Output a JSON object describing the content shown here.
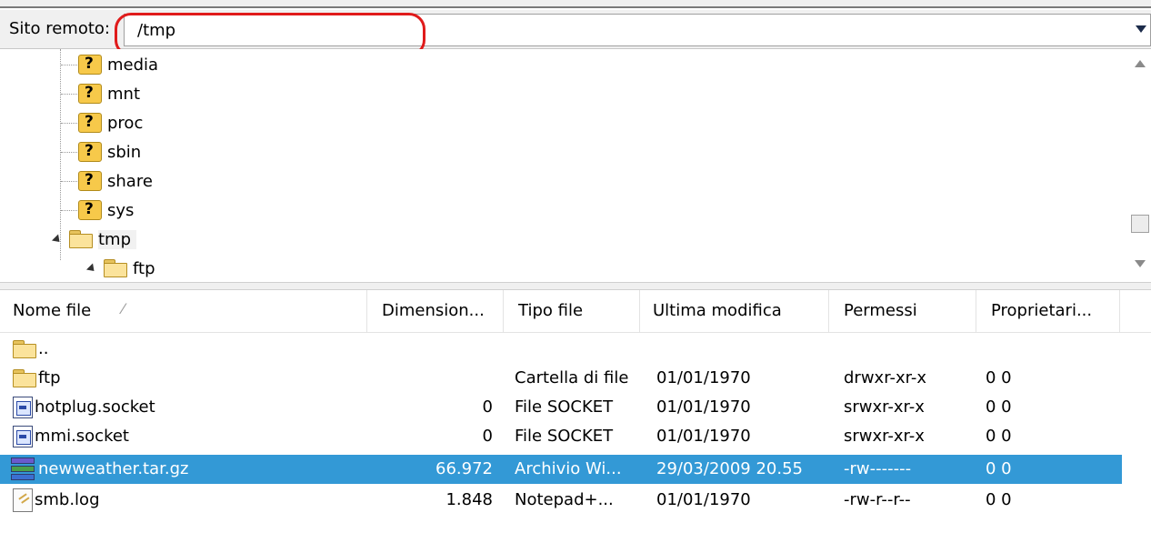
{
  "remote": {
    "label": "Sito remoto:",
    "path": "/tmp"
  },
  "tree": {
    "items": [
      {
        "label": "media",
        "icon": "unknown-folder-icon"
      },
      {
        "label": "mnt",
        "icon": "unknown-folder-icon"
      },
      {
        "label": "proc",
        "icon": "unknown-folder-icon"
      },
      {
        "label": "sbin",
        "icon": "unknown-folder-icon"
      },
      {
        "label": "share",
        "icon": "unknown-folder-icon"
      },
      {
        "label": "sys",
        "icon": "unknown-folder-icon"
      },
      {
        "label": "tmp",
        "icon": "folder-icon",
        "expanded": true,
        "selected": true
      },
      {
        "label": "ftp",
        "icon": "folder-icon",
        "expanded": true
      }
    ]
  },
  "columns": {
    "name": "Nome file",
    "size": "Dimension...",
    "type": "Tipo file",
    "modified": "Ultima modifica",
    "perms": "Permessi",
    "owner": "Proprietari..."
  },
  "files": [
    {
      "name": "..",
      "size": "",
      "type": "",
      "modified": "",
      "perms": "",
      "owner": "",
      "icon": "folder-up-icon"
    },
    {
      "name": "ftp",
      "size": "",
      "type": "Cartella di file",
      "modified": "01/01/1970",
      "perms": "drwxr-xr-x",
      "owner": "0 0",
      "icon": "folder-icon"
    },
    {
      "name": "hotplug.socket",
      "size": "0",
      "type": "File SOCKET",
      "modified": "01/01/1970",
      "perms": "srwxr-xr-x",
      "owner": "0 0",
      "icon": "socket-file-icon"
    },
    {
      "name": "mmi.socket",
      "size": "0",
      "type": "File SOCKET",
      "modified": "01/01/1970",
      "perms": "srwxr-xr-x",
      "owner": "0 0",
      "icon": "socket-file-icon"
    },
    {
      "name": "newweather.tar.gz",
      "size": "66.972",
      "type": "Archivio Wi...",
      "modified": "29/03/2009 20.55",
      "perms": "-rw-------",
      "owner": "0 0",
      "icon": "archive-icon",
      "selected": true
    },
    {
      "name": "smb.log",
      "size": "1.848",
      "type": "Notepad+...",
      "modified": "01/01/1970",
      "perms": "-rw-r--r--",
      "owner": "0 0",
      "icon": "notepad-file-icon"
    }
  ],
  "colors": {
    "selection": "#3399d6",
    "highlight_ring": "#e01b1b"
  }
}
